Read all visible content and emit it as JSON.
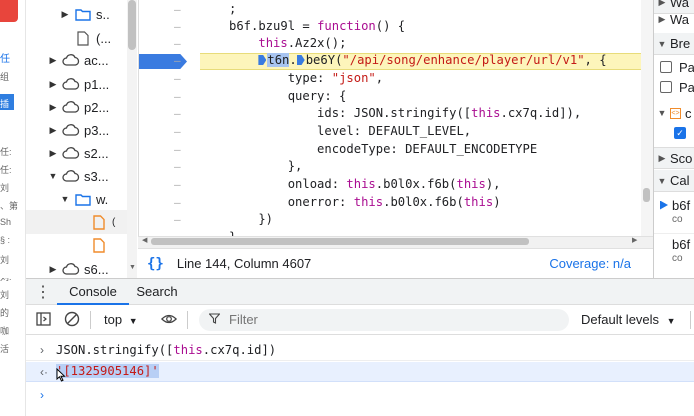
{
  "page_strip": {
    "items": [
      "任",
      "组",
      "插",
      "任:",
      "任:",
      "刘",
      "、第",
      "Sh",
      "§ :",
      "刘",
      "刘:",
      "刘",
      "的",
      "咖",
      "活"
    ]
  },
  "file_tree": {
    "rows": [
      {
        "label": "s..",
        "icon": "folder-icon",
        "arrow": "right"
      },
      {
        "label": "(...",
        "icon": "file-icon",
        "arrow": ""
      },
      {
        "label": "ac...",
        "icon": "cloud-icon",
        "arrow": "right"
      },
      {
        "label": "p1...",
        "icon": "cloud-icon",
        "arrow": "right"
      },
      {
        "label": "p2...",
        "icon": "cloud-icon",
        "arrow": "right"
      },
      {
        "label": "p3...",
        "icon": "cloud-icon",
        "arrow": "right"
      },
      {
        "label": "s2...",
        "icon": "cloud-icon",
        "arrow": "right"
      },
      {
        "label": "s3...",
        "icon": "cloud-icon",
        "arrow": "down"
      },
      {
        "label": "w.",
        "icon": "folder-icon",
        "arrow": "down"
      },
      {
        "label": "(",
        "icon": "file-js-icon",
        "arrow": ""
      },
      {
        "label": "",
        "icon": "file-js-icon",
        "arrow": ""
      },
      {
        "label": "s6...",
        "icon": "cloud-icon",
        "arrow": "right"
      }
    ]
  },
  "editor": {
    "lines": [
      {
        "tokens": [
          {
            "t": ";",
            "c": ""
          }
        ]
      },
      {
        "tokens": [
          {
            "t": "b6f.bzu9l = ",
            "c": ""
          },
          {
            "t": "function",
            "c": "kw"
          },
          {
            "t": "() {",
            "c": ""
          }
        ]
      },
      {
        "tokens": [
          {
            "t": "    ",
            "c": ""
          },
          {
            "t": "this",
            "c": "kw"
          },
          {
            "t": ".Az2x();",
            "c": ""
          }
        ]
      },
      {
        "tokens": [
          {
            "t": "    ",
            "c": ""
          },
          {
            "t": "BP",
            "c": "bp"
          },
          {
            "t": "t6n",
            "c": "hl"
          },
          {
            "t": ".",
            "c": ""
          },
          {
            "t": "BP",
            "c": "bp"
          },
          {
            "t": "be6Y(",
            "c": ""
          },
          {
            "t": "\"/api/song/enhance/player/url/v1\"",
            "c": "str"
          },
          {
            "t": ", {",
            "c": ""
          }
        ]
      },
      {
        "tokens": [
          {
            "t": "        type: ",
            "c": ""
          },
          {
            "t": "\"json\"",
            "c": "str"
          },
          {
            "t": ",",
            "c": ""
          }
        ]
      },
      {
        "tokens": [
          {
            "t": "        query: {",
            "c": ""
          }
        ]
      },
      {
        "tokens": [
          {
            "t": "            ids: JSON.stringify([",
            "c": ""
          },
          {
            "t": "this",
            "c": "kw"
          },
          {
            "t": ".cx7q.id]),",
            "c": ""
          }
        ]
      },
      {
        "tokens": [
          {
            "t": "            level: DEFAULT_LEVEL,",
            "c": ""
          }
        ]
      },
      {
        "tokens": [
          {
            "t": "            encodeType: DEFAULT_ENCODETYPE",
            "c": ""
          }
        ]
      },
      {
        "tokens": [
          {
            "t": "        },",
            "c": ""
          }
        ]
      },
      {
        "tokens": [
          {
            "t": "        onload: ",
            "c": ""
          },
          {
            "t": "this",
            "c": "kw"
          },
          {
            "t": ".b0l0x.f6b(",
            "c": ""
          },
          {
            "t": "this",
            "c": "kw"
          },
          {
            "t": "),",
            "c": ""
          }
        ]
      },
      {
        "tokens": [
          {
            "t": "        onerror: ",
            "c": ""
          },
          {
            "t": "this",
            "c": "kw"
          },
          {
            "t": ".b0l0x.f6b(",
            "c": ""
          },
          {
            "t": "this",
            "c": "kw"
          },
          {
            "t": ")",
            "c": ""
          }
        ]
      },
      {
        "tokens": [
          {
            "t": "    })",
            "c": ""
          }
        ]
      },
      {
        "tokens": [
          {
            "t": "}",
            "c": ""
          }
        ]
      }
    ]
  },
  "status_bar": {
    "pretty_print": "{}",
    "cursor_position": "Line 144, Column 4607",
    "coverage": "Coverage: n/a"
  },
  "right_panel": {
    "rows": [
      {
        "type": "head",
        "arrow": "right",
        "label": "Wa"
      },
      {
        "type": "head",
        "arrow": "down",
        "label": "Bre"
      },
      {
        "type": "check",
        "checked": false,
        "label": "Pau"
      },
      {
        "type": "check",
        "checked": false,
        "label": "Pau"
      },
      {
        "type": "group",
        "arrow": "down",
        "label": "c"
      },
      {
        "type": "check",
        "checked": true,
        "label": ""
      },
      {
        "type": "head",
        "arrow": "right",
        "label": "Sco"
      },
      {
        "type": "head",
        "arrow": "down",
        "label": "Cal"
      },
      {
        "type": "frame",
        "active": true,
        "label": "b6f",
        "sub": "co"
      },
      {
        "type": "frame",
        "active": false,
        "label": "b6f",
        "sub": "co"
      }
    ]
  },
  "drawer": {
    "tabs": [
      "Console",
      "Search"
    ]
  },
  "console_toolbar": {
    "context": "top",
    "filter_placeholder": "Filter",
    "levels": "Default levels"
  },
  "console": {
    "input_prefix": "JSON.stringify([",
    "input_kw": "this",
    "input_suffix": ".cx7q.id])",
    "output": "'[1325905146]'"
  }
}
